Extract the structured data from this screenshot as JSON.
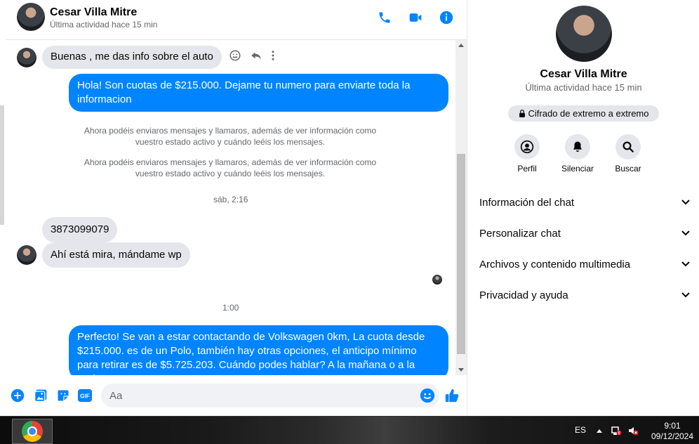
{
  "contact": {
    "name": "Cesar Villa Mitre",
    "last_active": "Última actividad hace 15 min"
  },
  "colors": {
    "accent": "#0084ff",
    "incoming_bubble": "#e4e6eb",
    "secondary_text": "#65676b"
  },
  "messages": {
    "m1": "Buenas , me das info sobre el auto",
    "m2": "Hola! Son cuotas de $215.000. Dejame tu numero para enviarte toda la informacion",
    "sys1_line1": "Ahora podéis enviaros mensajes y llamaros, además de ver información como",
    "sys1_line2": "vuestro estado activo y cuándo leéis los mensajes.",
    "sys2_line1": "Ahora podéis enviaros mensajes y llamaros, además de ver información como",
    "sys2_line2": "vuestro estado activo y cuándo leéis los mensajes.",
    "ts1": "sáb, 2:16",
    "m3": "3873099079",
    "m4": "Ahí está mira, mándame wp",
    "ts2": "1:00",
    "m5": "Perfecto!  Se van a estar contactando de Volkswagen 0km, La cuota desde $215.000. es de un Polo, también hay otras opciones, el anticipo mínimo para retirar es de $5.725.203. Cuándo podes hablar? A la mañana o a la tarde?"
  },
  "composer": {
    "placeholder": "Aa"
  },
  "info_panel": {
    "encryption": "Cifrado de extremo a extremo",
    "actions": [
      "Perfil",
      "Silenciar",
      "Buscar"
    ],
    "sections": [
      "Información del chat",
      "Personalizar chat",
      "Archivos y contenido multimedia",
      "Privacidad y ayuda"
    ]
  },
  "taskbar": {
    "language": "ES",
    "time": "9:01",
    "date": "09/12/2024"
  }
}
